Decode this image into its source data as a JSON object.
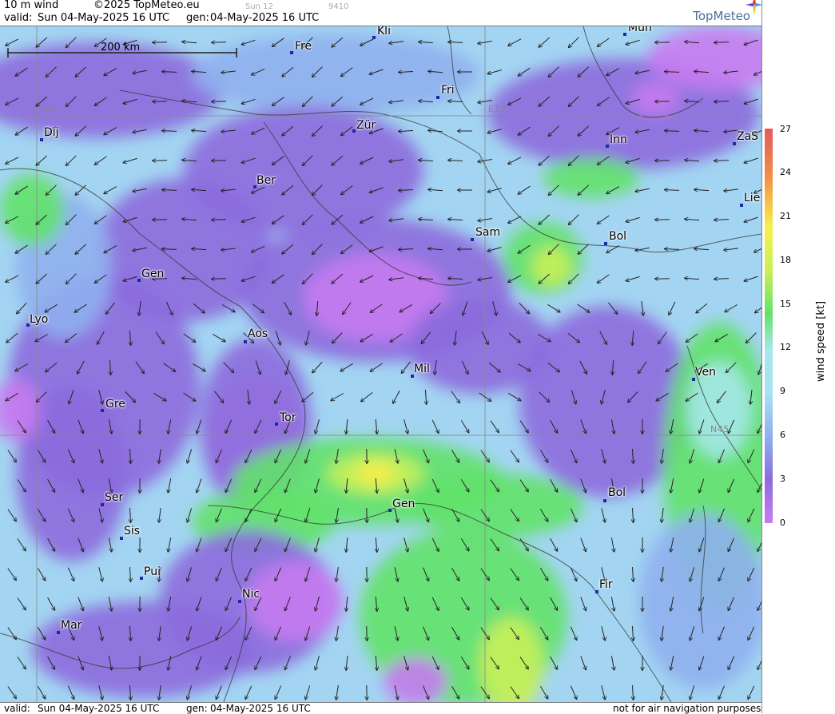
{
  "header": {
    "product": "10 m wind",
    "copyright": "©2025 TopMeteo.eu",
    "valid_label": "valid:",
    "valid_time": "Sun  04-May-2025  16 UTC",
    "gen_label": "gen:",
    "gen_time": "04-May-2025 16 UTC",
    "faint_code1": "Sun 12",
    "faint_code2": "9410",
    "logo": "TopMeteo"
  },
  "map": {
    "scale_label": "200 km",
    "grid_labels": [
      "E05",
      "E10",
      "N45"
    ],
    "cities": [
      "Kli",
      "Mün",
      "Fre",
      "Fri",
      "Dij",
      "Zür",
      "Inn",
      "ZaS",
      "Ber",
      "Lie",
      "Sam",
      "Bol",
      "Gen",
      "Lyo",
      "Aos",
      "Mil",
      "Ven",
      "Gre",
      "Tor",
      "Ser",
      "Gen",
      "Bol",
      "Sis",
      "Pui",
      "Fir",
      "Nic",
      "Mar"
    ]
  },
  "footer": {
    "valid_label": "valid:",
    "valid_time": "Sun  04-May-2025  16 UTC",
    "gen_label": "gen:",
    "gen_time": "04-May-2025 16 UTC",
    "disclaimer": "not for air navigation purposes"
  },
  "legend": {
    "title": "wind speed [kt]",
    "ticks": [
      "27",
      "24",
      "21",
      "18",
      "15",
      "12",
      "9",
      "6",
      "3",
      "0"
    ],
    "colors": {
      "c0": "#c77bf0",
      "c3": "#8d6cdd",
      "c6": "#8fb0ee",
      "c9": "#a7e3f4",
      "c12": "#a6e7ea",
      "c15": "#62e26a",
      "c18": "#c9ef5a",
      "c21": "#f7f04c",
      "c24": "#f28e47",
      "c27": "#e25b5b"
    }
  }
}
